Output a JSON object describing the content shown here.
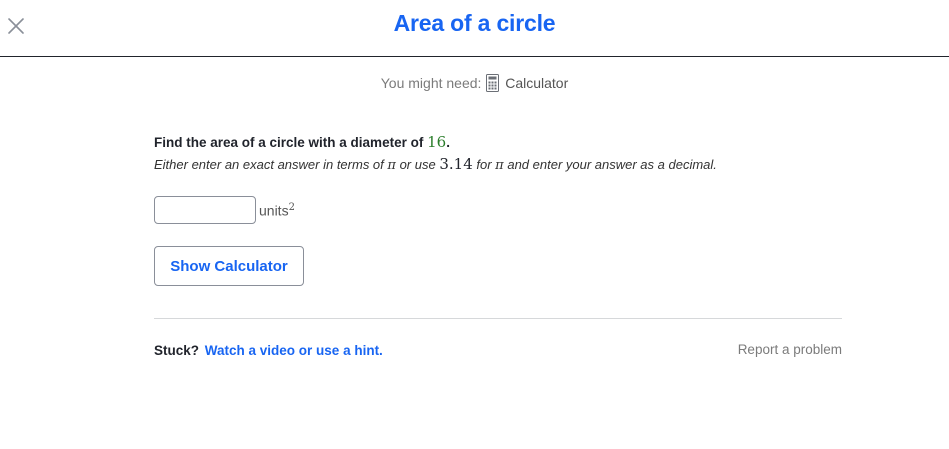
{
  "header": {
    "close_icon": "close-icon",
    "title": "Area of a circle"
  },
  "might_need": {
    "label": "You might need:",
    "tool_icon": "calculator-icon",
    "tool_label": "Calculator"
  },
  "problem": {
    "question_text": "Find the area of a circle with a diameter of",
    "diameter_value": "16",
    "question_end": ".",
    "instruction_1": "Either enter an exact answer in terms of",
    "pi_symbol": "π",
    "instruction_2": "or use",
    "pi_approx": "3.14",
    "instruction_3": "for",
    "instruction_4": "and enter your answer as a decimal."
  },
  "answer": {
    "value": "",
    "units_label": "units",
    "units_exponent": "2"
  },
  "actions": {
    "show_calculator_label": "Show Calculator"
  },
  "footer": {
    "stuck_label": "Stuck?",
    "hint_link_label": "Watch a video or use a hint.",
    "report_label": "Report a problem"
  },
  "colors": {
    "accent": "#1865f2",
    "number_green": "#2a7d2a",
    "text": "#21242c",
    "muted": "#7b7b7b"
  }
}
